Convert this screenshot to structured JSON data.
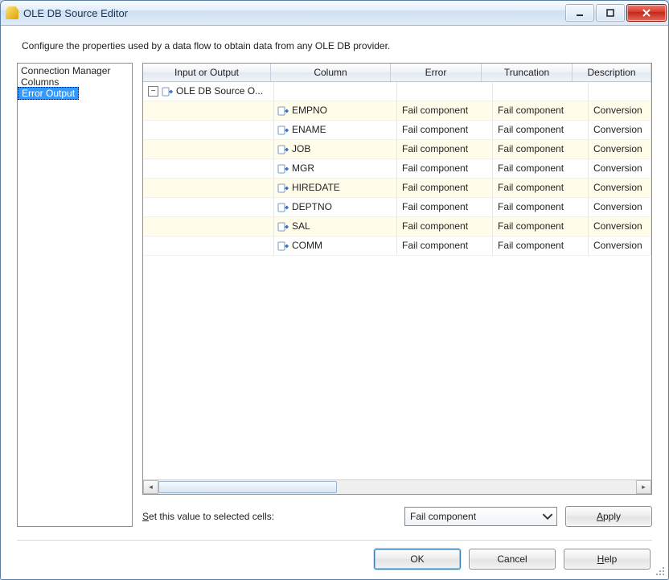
{
  "window": {
    "title": "OLE DB Source Editor"
  },
  "instruction": "Configure the properties used by a data flow to obtain data from any OLE DB provider.",
  "nav": {
    "items": [
      {
        "label": "Connection Manager",
        "selected": false
      },
      {
        "label": "Columns",
        "selected": false
      },
      {
        "label": "Error Output",
        "selected": true
      }
    ]
  },
  "grid": {
    "headers": {
      "input_or_output": "Input or Output",
      "column": "Column",
      "error": "Error",
      "truncation": "Truncation",
      "description": "Description"
    },
    "output_name": "OLE DB Source O...",
    "rows": [
      {
        "column": "EMPNO",
        "error": "Fail component",
        "truncation": "Fail component",
        "description": "Conversion"
      },
      {
        "column": "ENAME",
        "error": "Fail component",
        "truncation": "Fail component",
        "description": "Conversion"
      },
      {
        "column": "JOB",
        "error": "Fail component",
        "truncation": "Fail component",
        "description": "Conversion"
      },
      {
        "column": "MGR",
        "error": "Fail component",
        "truncation": "Fail component",
        "description": "Conversion"
      },
      {
        "column": "HIREDATE",
        "error": "Fail component",
        "truncation": "Fail component",
        "description": "Conversion"
      },
      {
        "column": "DEPTNO",
        "error": "Fail component",
        "truncation": "Fail component",
        "description": "Conversion"
      },
      {
        "column": "SAL",
        "error": "Fail component",
        "truncation": "Fail component",
        "description": "Conversion"
      },
      {
        "column": "COMM",
        "error": "Fail component",
        "truncation": "Fail component",
        "description": "Conversion"
      }
    ]
  },
  "below": {
    "label_pre": "S",
    "label_rest": "et this value to selected cells:",
    "combo_value": "Fail component",
    "apply_pre": "A",
    "apply_rest": "pply"
  },
  "footer": {
    "ok": "OK",
    "cancel": "Cancel",
    "help_pre": "H",
    "help_rest": "elp"
  }
}
